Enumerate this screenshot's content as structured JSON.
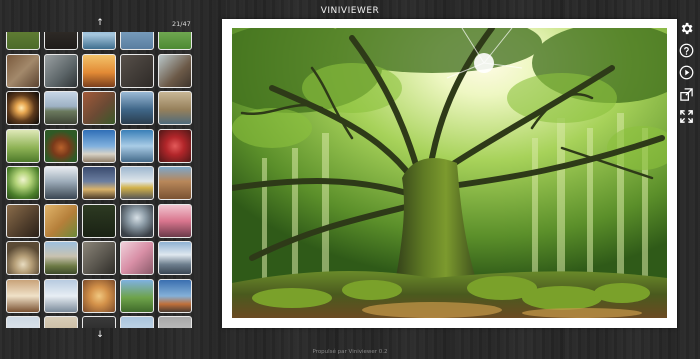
{
  "app": {
    "title": "VINIVIEWER"
  },
  "navigator": {
    "counter": "21/47",
    "up_icon": "arrow-up-icon",
    "down_icon": "arrow-down-icon",
    "up_glyph": "↑",
    "down_glyph": "↓"
  },
  "thumbnails": [
    {
      "name": "thumb-grass-field",
      "bg": "linear-gradient(#6f8a3a 0%,#4c6b2b 100%)"
    },
    {
      "name": "thumb-dark-hall",
      "bg": "linear-gradient(#3a3530,#1f1c1a)"
    },
    {
      "name": "thumb-pier-sea",
      "bg": "linear-gradient(#6da2c9,#a6c7de 55%,#3f6f8f)"
    },
    {
      "name": "thumb-city-blue",
      "bg": "linear-gradient(#8fb4d2,#5a7ea0)"
    },
    {
      "name": "thumb-green-field",
      "bg": "linear-gradient(#8dc06a,#4d8a33)"
    },
    {
      "name": "thumb-ruins",
      "bg": "linear-gradient(135deg,#7a5a3d,#a3896b 50%,#5b4330)"
    },
    {
      "name": "thumb-machinery",
      "bg": "linear-gradient(135deg,#9aa0a2,#5b6467 60%,#2f3436)"
    },
    {
      "name": "thumb-sunset-sky",
      "bg": "linear-gradient(#f3c36a,#e28a35 55%,#7a3f1d)"
    },
    {
      "name": "thumb-dark-rocks",
      "bg": "linear-gradient(135deg,#57504a,#2e2a27)"
    },
    {
      "name": "thumb-waterfall",
      "bg": "linear-gradient(135deg,#b9c6c8,#6c5a48 60%,#3e342c)"
    },
    {
      "name": "thumb-light-bulb",
      "bg": "radial-gradient(circle at 45% 50%,#ffe9b0 0,#e7a650 22%,#5e3a1c 55%,#1b120b 90%)"
    },
    {
      "name": "thumb-road",
      "bg": "linear-gradient(#c7d6e6,#9db1c4 45%,#6b7a5e 60%,#3e4436)"
    },
    {
      "name": "thumb-tree-rock",
      "bg": "linear-gradient(135deg,#a25a3a,#6b4a34 55%,#3a5a2a)"
    },
    {
      "name": "thumb-sea-rocks",
      "bg": "linear-gradient(#9bbad6,#3f6688 55%,#2a3d4e)"
    },
    {
      "name": "thumb-seashore",
      "bg": "linear-gradient(#c8b796,#96805b 55%,#4f6b7c)"
    },
    {
      "name": "thumb-green-landscape",
      "bg": "linear-gradient(#dfe8b8,#8fb356 55%,#4e7a2a)"
    },
    {
      "name": "thumb-red-panda",
      "bg": "radial-gradient(circle at 50% 55%,#b9622c 0,#7a3a1a 35%,#2f5a26 70%)"
    },
    {
      "name": "thumb-pier-blue",
      "bg": "linear-gradient(#2f6fb7,#7fb0de 50%,#d8d2c6 75%,#8f7e68)"
    },
    {
      "name": "thumb-blue-lake",
      "bg": "linear-gradient(#3a7fb8,#a9cce6 50%,#446a8a)"
    },
    {
      "name": "thumb-red-heart",
      "bg": "radial-gradient(circle at 50% 50%,#e35a5a 0,#b2262a 40%,#5e1a1a 90%)"
    },
    {
      "name": "thumb-palm-tree",
      "bg": "radial-gradient(circle at 50% 40%,#f0f4cf 0,#b4d47a 30%,#4a7e2a 70%,#2c4a1c)"
    },
    {
      "name": "thumb-light-rays",
      "bg": "linear-gradient(#e8ecf0,#9eadba 45%,#3a4652)"
    },
    {
      "name": "thumb-night-city",
      "bg": "linear-gradient(#3a4b6e,#6b7ea0 45%,#d9b36a 70%,#4a3a2a)"
    },
    {
      "name": "thumb-trucks",
      "bg": "linear-gradient(#9db7cf,#dfe6ea 45%,#d2b24a 65%,#555)"
    },
    {
      "name": "thumb-canyon",
      "bg": "linear-gradient(#7da6c8,#b8875a 45%,#7a5232)"
    },
    {
      "name": "thumb-broken-car",
      "bg": "linear-gradient(135deg,#8a6c4a,#4f3d2b 60%,#2a2018)"
    },
    {
      "name": "thumb-wheat",
      "bg": "linear-gradient(135deg,#e0b46a,#b57f3a 55%,#6b8a3a)"
    },
    {
      "name": "thumb-dark-forest",
      "bg": "linear-gradient(#2d3a22,#1a2214)"
    },
    {
      "name": "thumb-fog-lake",
      "bg": "radial-gradient(circle at 50% 40%,#d7e0e6 0,#8c9ba6 35%,#3a4047 80%)"
    },
    {
      "name": "thumb-pink-train",
      "bg": "linear-gradient(#f1c6d0,#d9768e 50%,#6b3a4a)"
    },
    {
      "name": "thumb-cave",
      "bg": "radial-gradient(circle at 50% 70%,#e8dcc0 0,#b69f78 30%,#5a4a35 70%)"
    },
    {
      "name": "thumb-castle",
      "bg": "linear-gradient(#9ec0de,#c9c2b0 45%,#6d7a45 75%,#3d4a2a)"
    },
    {
      "name": "thumb-old-tv",
      "bg": "linear-gradient(135deg,#8a8478,#5a564e 55%,#2e2c28)"
    },
    {
      "name": "thumb-blossom",
      "bg": "linear-gradient(135deg,#f0d0da,#d88fa6 50%,#8a5a6a)"
    },
    {
      "name": "thumb-mountains",
      "bg": "linear-gradient(#8fb2d3,#dfe7ef 40%,#6e7f8e 70%,#3a4654)"
    },
    {
      "name": "thumb-book",
      "bg": "linear-gradient(#c9a37a,#f0e2c8 50%,#7a5232)"
    },
    {
      "name": "thumb-snow-village",
      "bg": "linear-gradient(#b8cbe0,#e8eef4 50%,#7a8a9a)"
    },
    {
      "name": "thumb-shell",
      "bg": "radial-gradient(circle at 50% 50%,#f0c780 0,#d4924a 40%,#7a4a2a)"
    },
    {
      "name": "thumb-green-hills",
      "bg": "linear-gradient(#7fb1e0,#6ea34a 55%,#3f6a2a)"
    },
    {
      "name": "thumb-harbor",
      "bg": "linear-gradient(#3a6fb0,#84b0d8 50%,#c0703a 75%,#4a3a30)"
    },
    {
      "name": "thumb-sky-horizon",
      "bg": "linear-gradient(#cdd8e3,#f1f3f5)"
    },
    {
      "name": "thumb-beige",
      "bg": "linear-gradient(#d8cdb8,#b9a88a)"
    },
    {
      "name": "thumb-dark-bottom",
      "bg": "linear-gradient(#3a3a3a,#1c1c1c)"
    },
    {
      "name": "thumb-sky-bottom",
      "bg": "linear-gradient(#a9c4dc,#dfe9f2)"
    },
    {
      "name": "thumb-gray-bottom",
      "bg": "linear-gradient(#a8a8a8,#d6d6d6)"
    }
  ],
  "toolbar": [
    {
      "name": "settings-gear-icon",
      "label": "settings"
    },
    {
      "name": "help-icon",
      "label": "help"
    },
    {
      "name": "play-slideshow-icon",
      "label": "play"
    },
    {
      "name": "open-external-icon",
      "label": "open"
    },
    {
      "name": "fullscreen-icon",
      "label": "fullscreen"
    }
  ],
  "main_image": {
    "name": "main-photo-mossy-tree"
  },
  "footer": {
    "text": "Propulsé par Viniviewer 0.2"
  }
}
